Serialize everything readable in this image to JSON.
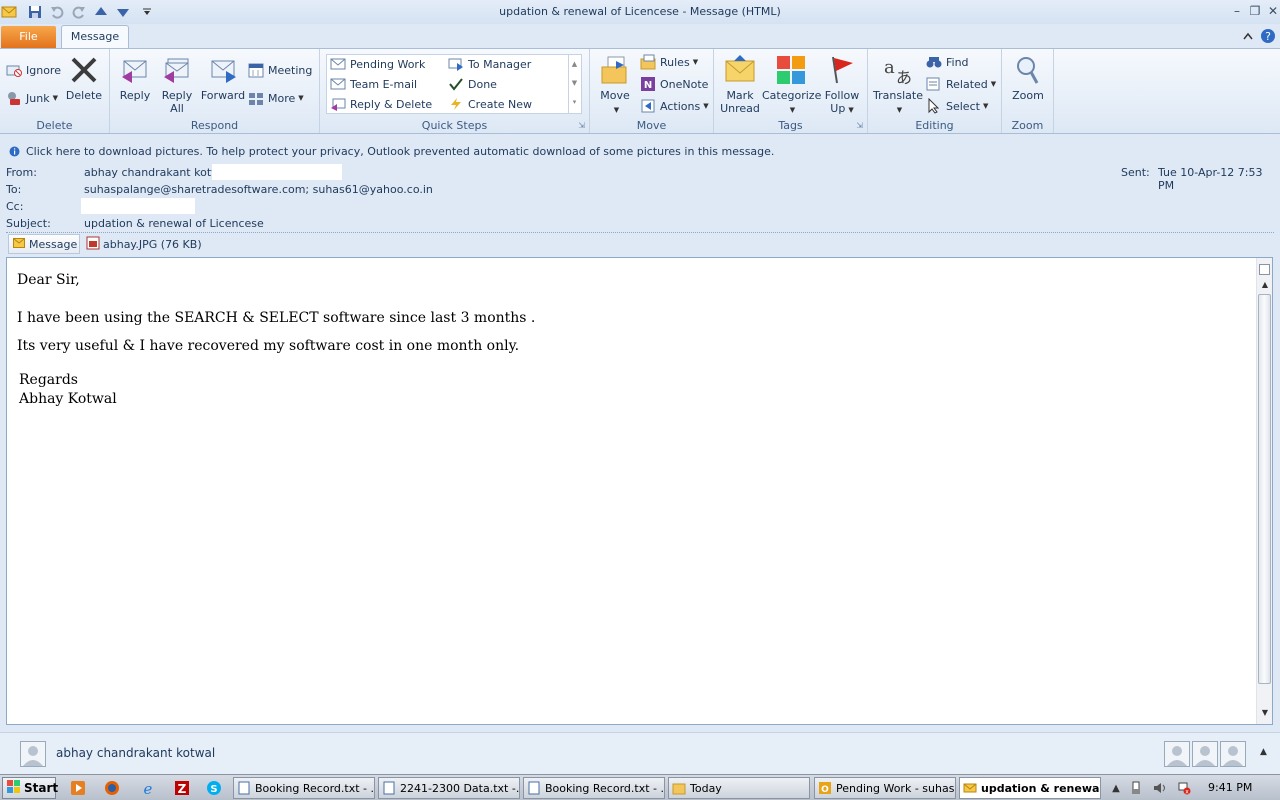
{
  "window": {
    "title": "updation & renewal of Licencese  - Message (HTML)"
  },
  "tabs": {
    "file": "File",
    "message": "Message"
  },
  "ribbon": {
    "delete_group": {
      "label": "Delete",
      "ignore": "Ignore",
      "junk": "Junk",
      "delete": "Delete"
    },
    "respond_group": {
      "label": "Respond",
      "reply": "Reply",
      "reply_all_1": "Reply",
      "reply_all_2": "All",
      "forward": "Forward",
      "meeting": "Meeting",
      "more": "More"
    },
    "quicksteps_group": {
      "label": "Quick Steps",
      "items": [
        "Pending Work",
        "To Manager",
        "Team E-mail",
        "Done",
        "Reply & Delete",
        "Create New"
      ]
    },
    "move_group": {
      "label": "Move",
      "move": "Move",
      "rules": "Rules",
      "onenote": "OneNote",
      "actions": "Actions"
    },
    "tags_group": {
      "label": "Tags",
      "mark_unread_1": "Mark",
      "mark_unread_2": "Unread",
      "categorize": "Categorize",
      "follow_up_1": "Follow",
      "follow_up_2": "Up"
    },
    "editing_group": {
      "label": "Editing",
      "translate": "Translate",
      "find": "Find",
      "related": "Related",
      "select": "Select"
    },
    "zoom_group": {
      "label": "Zoom",
      "zoom": "Zoom"
    }
  },
  "infobar": {
    "text": "Click here to download pictures. To help protect your privacy, Outlook prevented automatic download of some pictures in this message."
  },
  "header": {
    "from_label": "From:",
    "from_value": "abhay chandrakant kotwal",
    "to_label": "To:",
    "to_value": "suhaspalange@sharetradesoftware.com; suhas61@yahoo.co.in",
    "cc_label": "Cc:",
    "subject_label": "Subject:",
    "subject_value": "updation & renewal of Licencese",
    "sent_label": "Sent:",
    "sent_value": "Tue 10-Apr-12 7:53 PM"
  },
  "attachments": {
    "message_tab": "Message",
    "file": "abhay.JPG (76 KB)"
  },
  "body": {
    "greeting": "Dear Sir,",
    "line1": "I have been using the SEARCH & SELECT software since last 3 months .",
    "line2": "Its very useful & I have recovered my software cost in one month only.",
    "closing": "Regards",
    "signature": "Abhay Kotwal"
  },
  "people_pane": {
    "name": "abhay chandrakant kotwal"
  },
  "taskbar": {
    "start": "Start",
    "tasks": [
      "Booking Record.txt - ...",
      "2241-2300 Data.txt -...",
      "Booking Record.txt - ...",
      "Today",
      "Pending Work - suhas...",
      "updation & renewa..."
    ],
    "clock": "9:41 PM"
  }
}
